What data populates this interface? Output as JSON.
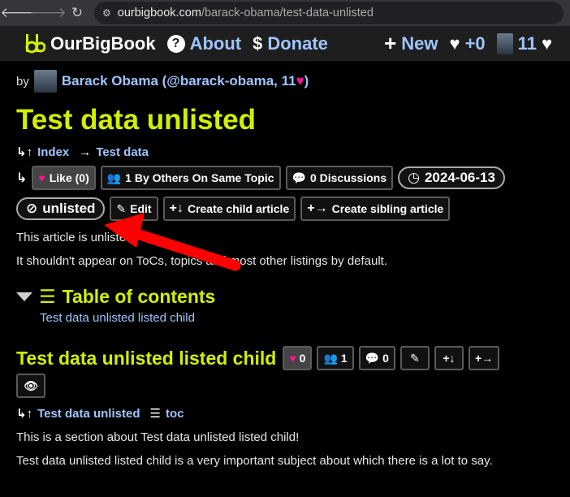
{
  "browser": {
    "url_host": "ourbigbook.com",
    "url_path": "/barack-obama/test-data-unlisted",
    "back_icon": "arrow-left-icon",
    "forward_icon": "arrow-right-icon",
    "reload_icon": "reload-icon"
  },
  "header": {
    "brand": "OurBigBook",
    "about": "About",
    "donate": "Donate",
    "new": "New",
    "hearts": "+0",
    "user_score": "11"
  },
  "byline": {
    "prefix": "by",
    "author": "Barack Obama (@barack-obama, 11",
    "author_close": ")"
  },
  "article": {
    "title": "Test data unlisted",
    "crumb_index": "Index",
    "crumb_parent": "Test data",
    "like_label": "Like (0)",
    "others_label": "1 By Others On Same Topic",
    "discussions_label": "0 Discussions",
    "date": "2024-06-13",
    "unlisted": "unlisted",
    "edit": "Edit",
    "create_child": "Create child article",
    "create_sibling": "Create sibling article",
    "para1": "This article is unlisted.",
    "para2": "It shouldn't appear on ToCs, topics and most other listings by default."
  },
  "toc": {
    "title": "Table of contents",
    "items": [
      "Test data unlisted listed child"
    ]
  },
  "section": {
    "title": "Test data unlisted listed child",
    "likes": "0",
    "others": "1",
    "discussions": "0",
    "crumb_parent": "Test data unlisted",
    "crumb_toc": "toc",
    "para1": "This is a section about Test data unlisted listed child!",
    "para2": "Test data unlisted listed child is a very important subject about which there is a lot to say."
  },
  "colors": {
    "accent_title": "#d2ef00",
    "link": "#9ec5fe",
    "heart": "#ff1493",
    "annotation": "#ff0000"
  }
}
